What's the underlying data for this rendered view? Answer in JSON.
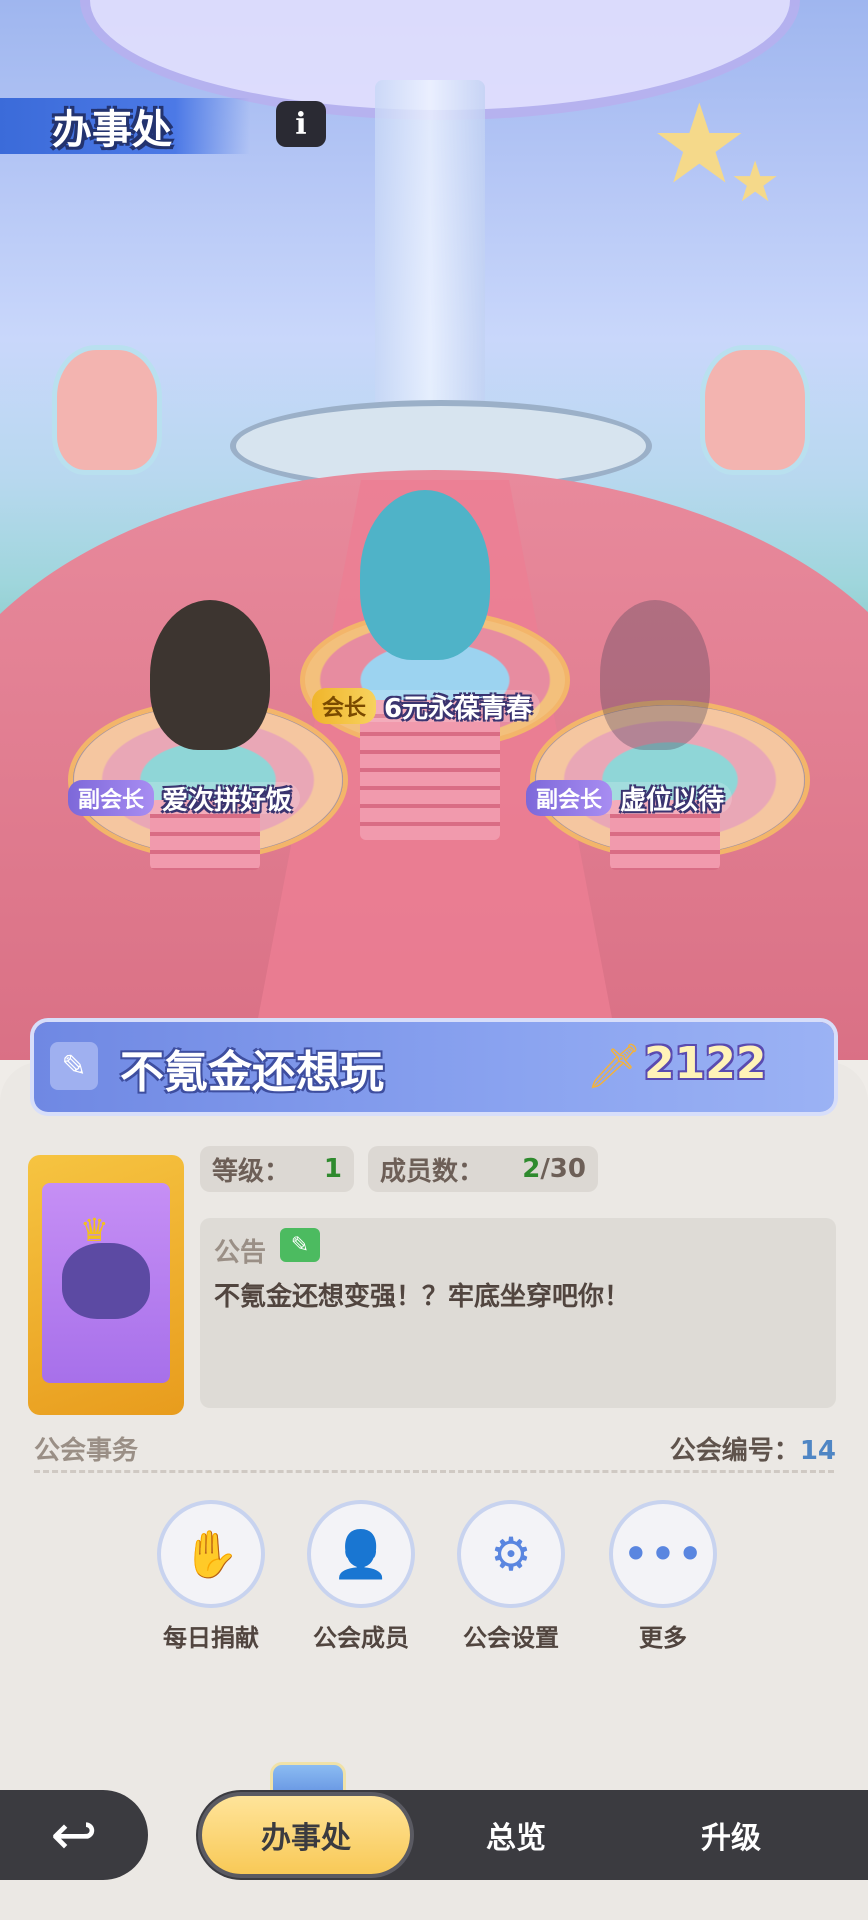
{
  "header": {
    "title": "办事处",
    "info_icon": "i"
  },
  "stage": {
    "president": {
      "role": "会长",
      "name": "6元永葆青春"
    },
    "vice_left": {
      "role": "副会长",
      "name": "爱次拼好饭"
    },
    "vice_right": {
      "role": "副会长",
      "name": "虚位以待"
    }
  },
  "guild": {
    "name": "不氪金还想玩",
    "power": "2122",
    "level_label": "等级：",
    "level": "1",
    "members_label": "成员数：",
    "members_current": "2",
    "members_max": "/30",
    "notice_label": "公告",
    "notice_text": "不氪金还想变强！？牢底坐穿吧你！",
    "affairs_label": "公会事务",
    "id_label": "公会编号：",
    "id": "14"
  },
  "actions": [
    {
      "label": "每日捐献",
      "icon": "donate-hand-icon"
    },
    {
      "label": "公会成员",
      "icon": "member-avatar-icon"
    },
    {
      "label": "公会设置",
      "icon": "gear-icon"
    },
    {
      "label": "更多",
      "icon": "more-dots-icon"
    }
  ],
  "nav": {
    "tabs": [
      "办事处",
      "总览",
      "升级"
    ],
    "active": "办事处"
  },
  "colors": {
    "accent_blue": "#6f88e3",
    "tab_active": "#f8c957",
    "level_green": "#2f8a2e",
    "id_blue": "#4f86c4"
  }
}
